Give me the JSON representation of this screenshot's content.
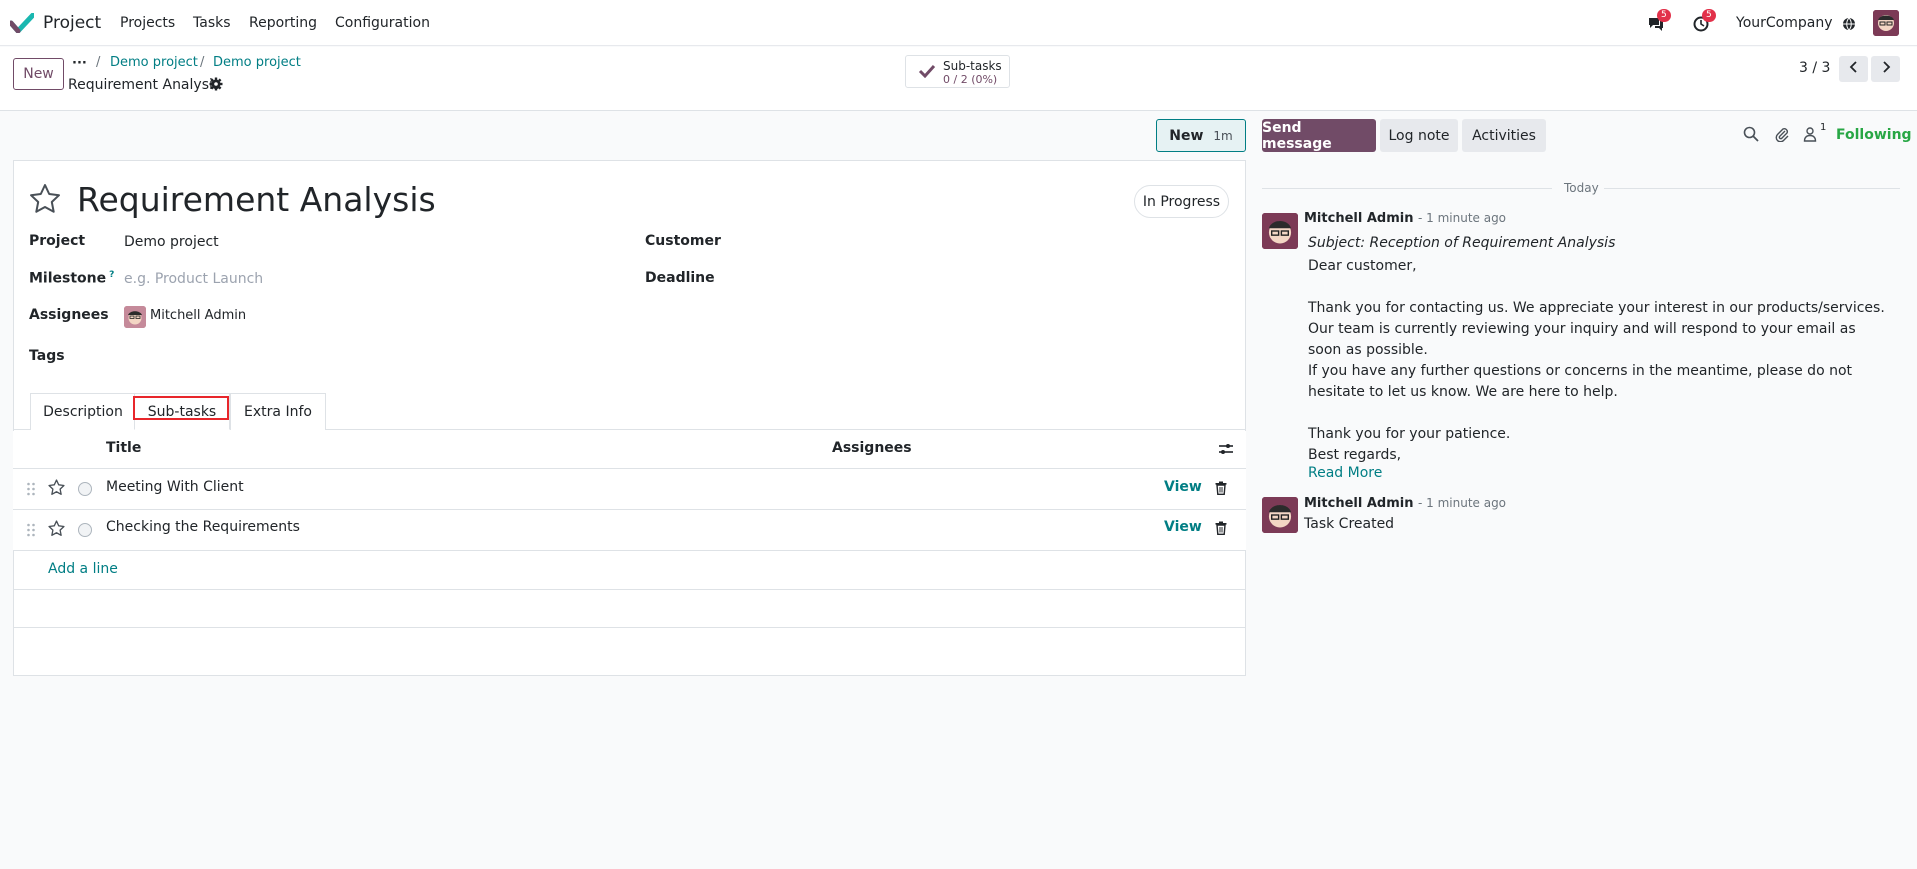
{
  "nav": {
    "app_name": "Project",
    "menu": [
      "Projects",
      "Tasks",
      "Reporting",
      "Configuration"
    ],
    "chat_badge": "5",
    "activity_badge": "5",
    "company": "YourCompany"
  },
  "control_panel": {
    "new_label": "New",
    "breadcrumb_dots": "···",
    "breadcrumb": [
      "Demo project",
      "Demo project"
    ],
    "current": "Requirement Analysis",
    "subtasks_label": "Sub-tasks",
    "subtasks_value": "0 / 2 (0%)",
    "pager": "3 / 3"
  },
  "form": {
    "stage_label": "New",
    "stage_time": "1m",
    "title": "Requirement Analysis",
    "state": "In Progress",
    "fields": {
      "project_label": "Project",
      "project_value": "Demo project",
      "milestone_label": "Milestone",
      "milestone_help": "?",
      "milestone_placeholder": "e.g. Product Launch",
      "assignees_label": "Assignees",
      "assignees_value": "Mitchell Admin",
      "tags_label": "Tags",
      "customer_label": "Customer",
      "deadline_label": "Deadline"
    },
    "tabs": [
      "Description",
      "Sub-tasks",
      "Extra Info"
    ],
    "list": {
      "col_title": "Title",
      "col_assignees": "Assignees",
      "rows": [
        {
          "title": "Meeting With Client",
          "action": "View"
        },
        {
          "title": "Checking the Requirements",
          "action": "View"
        }
      ],
      "add_line": "Add a line"
    }
  },
  "chatter": {
    "send_message": "Send message",
    "log_note": "Log note",
    "activities": "Activities",
    "follower_count": "1",
    "following": "Following",
    "date_separator": "Today",
    "messages": [
      {
        "author": "Mitchell Admin",
        "time": "- 1 minute ago",
        "subject": "Subject: Reception of Requirement Analysis",
        "body": "Dear customer,\n\nThank you for contacting us. We appreciate your interest in our products/services.\nOur team is currently reviewing your inquiry and will respond to your email as soon as possible.\nIf you have any further questions or concerns in the meantime, please do not hesitate to let us know. We are here to help.\n\nThank you for your patience.\nBest regards,",
        "read_more": "Read More"
      },
      {
        "author": "Mitchell Admin",
        "time": "- 1 minute ago",
        "body": "Task Created"
      }
    ]
  },
  "colors": {
    "brand": "#714b67",
    "link": "#017e84",
    "following": "#28a745",
    "highlight": "#e8262b"
  },
  "icons": [
    "app-logo-icon",
    "chat-icon",
    "clock-icon",
    "globe-icon",
    "gear-icon",
    "check-icon",
    "chevron-left-icon",
    "chevron-right-icon",
    "star-icon",
    "drag-handle-icon",
    "trash-icon",
    "column-options-icon",
    "search-icon",
    "paperclip-icon",
    "user-icon"
  ]
}
